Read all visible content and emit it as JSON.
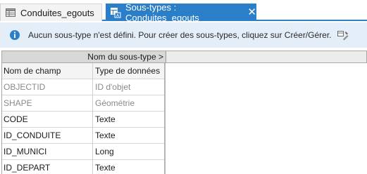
{
  "tabs": [
    {
      "label": "Conduites_egouts",
      "active": false
    },
    {
      "label": "Sous-types : Conduites_egouts",
      "active": true
    }
  ],
  "info": {
    "message": "Aucun sous-type n'est défini. Pour créer des sous-types, cliquez sur Créer/Gérer."
  },
  "subtype_header": {
    "label": "Nom du sous-type >"
  },
  "table": {
    "columns": [
      "Nom de champ",
      "Type de données"
    ],
    "rows": [
      {
        "field": "OBJECTID",
        "type": "ID d'objet",
        "readonly": true
      },
      {
        "field": "SHAPE",
        "type": "Géométrie",
        "readonly": true
      },
      {
        "field": "CODE",
        "type": "Texte",
        "readonly": false
      },
      {
        "field": "ID_CONDUITE",
        "type": "Texte",
        "readonly": false
      },
      {
        "field": "ID_MUNICI",
        "type": "Long",
        "readonly": false
      },
      {
        "field": "ID_DEPART",
        "type": "Texte",
        "readonly": false
      }
    ]
  },
  "colors": {
    "accent": "#2b7fc9",
    "info_bg": "#e3eef8"
  },
  "icons": {
    "table_tab": "table-icon",
    "subtype_tab": "subtypes-icon",
    "info": "info-icon",
    "manage": "manage-subtypes-icon"
  }
}
